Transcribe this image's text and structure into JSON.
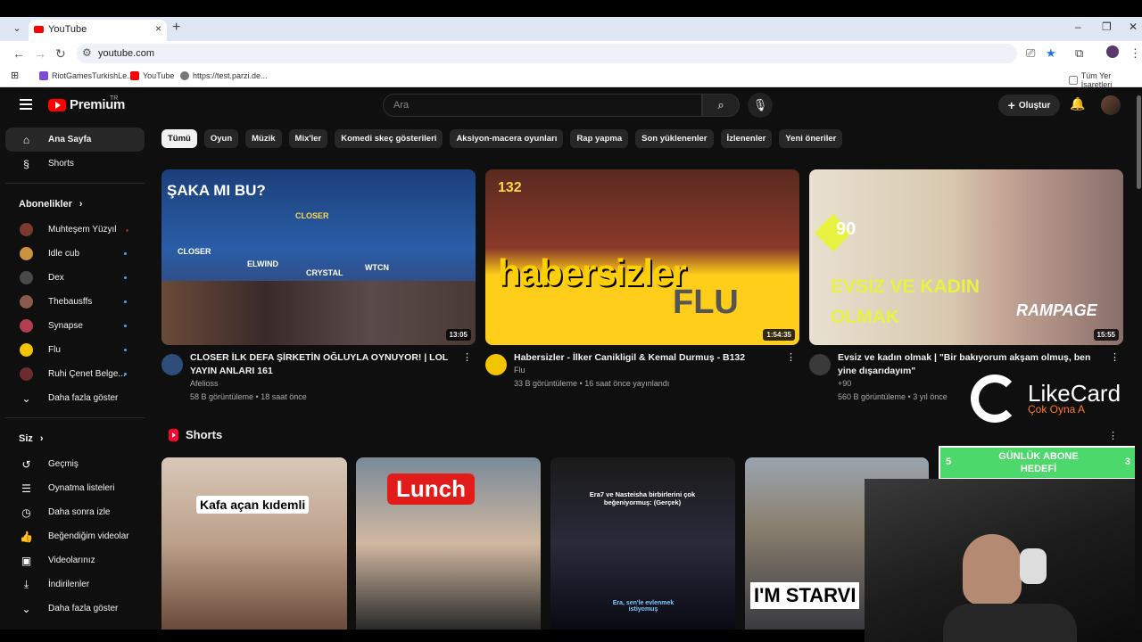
{
  "browser": {
    "tab_title": "YouTube",
    "url": "youtube.com",
    "bookmarks": [
      "RiotGamesTurkishLe...",
      "YouTube",
      "https://test.parzi.de..."
    ],
    "all_bookmarks": "Tüm Yer İşaretleri"
  },
  "header": {
    "logo_text": "Premium",
    "logo_super": "TR",
    "search_placeholder": "Ara",
    "create_label": "Oluştur"
  },
  "sidebar": {
    "main": [
      {
        "label": "Ana Sayfa",
        "icon": "home-icon"
      },
      {
        "label": "Shorts",
        "icon": "shorts-icon"
      }
    ],
    "subs_title": "Abonelikler",
    "subs": [
      {
        "label": "Muhteşem Yüzyıl",
        "color": "#7a3b2e",
        "indicator": "live"
      },
      {
        "label": "Idle cub",
        "color": "#c9933f",
        "indicator": "dot"
      },
      {
        "label": "Dex",
        "color": "#4a4a4a",
        "indicator": "dot"
      },
      {
        "label": "Thebausffs",
        "color": "#8b5a4a",
        "indicator": "dot"
      },
      {
        "label": "Synapse",
        "color": "#b04050",
        "indicator": "dot"
      },
      {
        "label": "Flu",
        "color": "#f2c500",
        "indicator": "dot"
      },
      {
        "label": "Ruhi Çenet Belge...",
        "color": "#6b2d2d",
        "indicator": "dot"
      }
    ],
    "show_more": "Daha fazla göster",
    "you_title": "Siz",
    "you": [
      {
        "label": "Geçmiş",
        "icon": "history-icon"
      },
      {
        "label": "Oynatma listeleri",
        "icon": "playlist-icon"
      },
      {
        "label": "Daha sonra izle",
        "icon": "clock-icon"
      },
      {
        "label": "Beğendiğim videolar",
        "icon": "like-icon"
      },
      {
        "label": "Videolarınız",
        "icon": "video-icon"
      },
      {
        "label": "İndirilenler",
        "icon": "download-icon"
      },
      {
        "label": "Daha fazla göster",
        "icon": "chevron-down-icon"
      }
    ]
  },
  "chips": [
    "Tümü",
    "Oyun",
    "Müzik",
    "Mix'ler",
    "Komedi skeç gösterileri",
    "Aksiyon-macera oyunları",
    "Rap yapma",
    "Son yüklenenler",
    "İzlenenler",
    "Yeni öneriler"
  ],
  "videos": [
    {
      "title": "CLOSER İLK DEFA ŞİRKETİN OĞLUYLA OYNUYOR! | LOL YAYIN ANLARI 161",
      "channel": "Afelioss",
      "stats": "58 B görüntüleme • 18 saat önce",
      "duration": "13:05",
      "thumb_text": [
        "ŞAKA MI BU?",
        "CLOSER",
        "ELWIND",
        "CRYSTAL",
        "WTCN",
        "CLOSER"
      ]
    },
    {
      "title": "Habersizler - İlker Canikligil & Kemal Durmuş - B132",
      "channel": "Flu",
      "stats": "33 B görüntüleme • 16 saat önce yayınlandı",
      "duration": "1:54:35",
      "thumb_text": [
        "habersizler",
        "FLU",
        "132"
      ]
    },
    {
      "title": "Evsiz ve kadın olmak | \"Bir bakıyorum akşam olmuş, ben yine dışarıdayım\"",
      "channel": "+90",
      "stats": "560 B görüntüleme • 3 yıl önce",
      "duration": "15:55",
      "thumb_text": [
        "EVSİZ VE KADIN",
        "OLMAK",
        "RAMPAGE",
        "90"
      ]
    }
  ],
  "shorts": {
    "title": "Shorts",
    "items": [
      {
        "caption": "Kafa açan kıdemli"
      },
      {
        "caption": "Lunch"
      },
      {
        "caption": "Era7 ve Nasteisha birbirlerini çok beğeniyormuş: (Gerçek)",
        "sub": "Era, sen'le evlenmek istiyomuş"
      },
      {
        "caption": "I'M STARVI"
      }
    ]
  },
  "overlay": {
    "brand_name": "LikeCard",
    "brand_tagline": "Çok Oyna  A",
    "goal_title": "GÜNLÜK ABONE HEDEFİ",
    "goal_left": "5",
    "goal_right": "3"
  }
}
